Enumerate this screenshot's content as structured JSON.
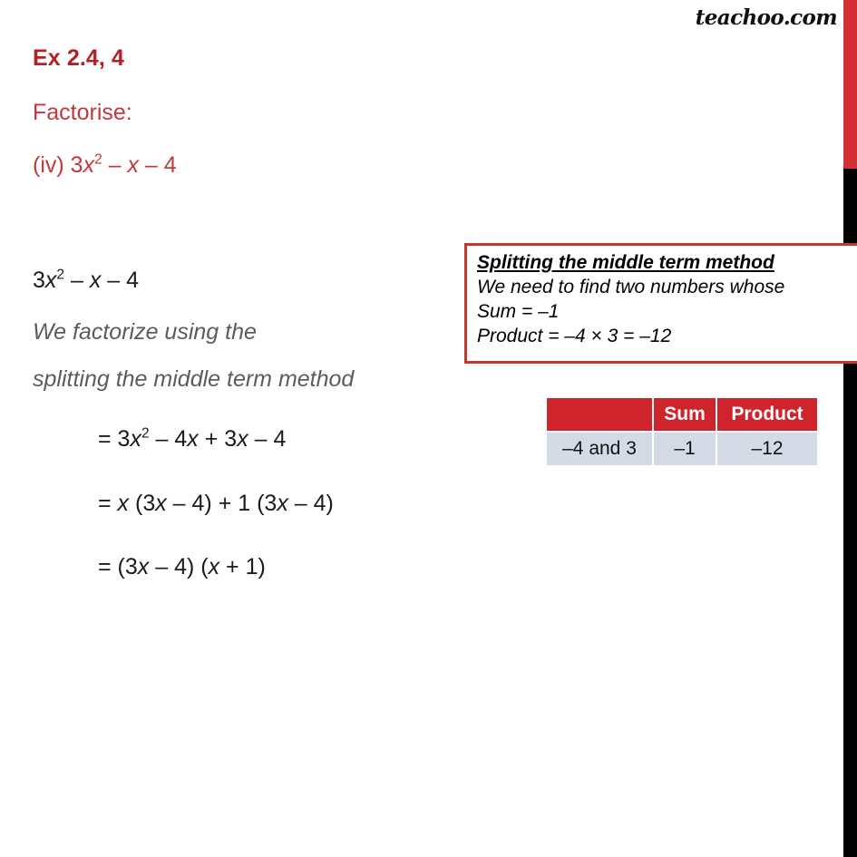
{
  "branding": {
    "logo_text": "teachoo.com"
  },
  "decor": {
    "edge_bar_red_color": "#d32f34",
    "edge_bar_black_color": "#000000",
    "accent_red": "#c0392f",
    "title_red": "#b32025",
    "table_header_red": "#d0242c",
    "table_row_blue": "#d5dbe6",
    "note_gray": "#5c5c5c"
  },
  "question": {
    "title": "Ex 2.4, 4",
    "prompt": "Factorise:",
    "part_prefix": "(iv) 3",
    "part_var": "x",
    "part_sup": "2",
    "part_rest": " – x – 4"
  },
  "solution": {
    "expression_prefix": "3",
    "expression_var": "x",
    "expression_sup": "2",
    "expression_rest": " – x – 4",
    "note_line_1": "We factorize using the",
    "note_line_2": "splitting the middle term method",
    "steps": [
      {
        "text": "= 3x2 – 4x + 3x – 4"
      },
      {
        "text": "= x (3x – 4) + 1 (3x – 4)"
      },
      {
        "text": "= (3x – 4) (x + 1)"
      }
    ],
    "step_1_a": "= 3",
    "step_1_var": "x",
    "step_1_sup": "2",
    "step_1_b": " – 4",
    "step_1_var2": "x",
    "step_1_c": " + 3",
    "step_1_var3": "x",
    "step_1_d": " – 4",
    "step_2_a": "= ",
    "step_2_var1": "x",
    "step_2_b": " (3",
    "step_2_var2": "x",
    "step_2_c": " – 4) + 1 (3",
    "step_2_var3": "x",
    "step_2_d": " – 4)",
    "step_3_a": "= (3",
    "step_3_var1": "x",
    "step_3_b": " – 4) (",
    "step_3_var2": "x",
    "step_3_c": " + 1)"
  },
  "info_box": {
    "title": "Splitting the middle term method",
    "line_1": "We need to find two numbers whose",
    "line_2": "Sum = –1",
    "line_3": "Product = –4 × 3 = –12"
  },
  "table": {
    "headers": [
      "",
      "Sum",
      "Product"
    ],
    "rows": [
      [
        "–4 and 3",
        "–1",
        "–12"
      ]
    ]
  }
}
